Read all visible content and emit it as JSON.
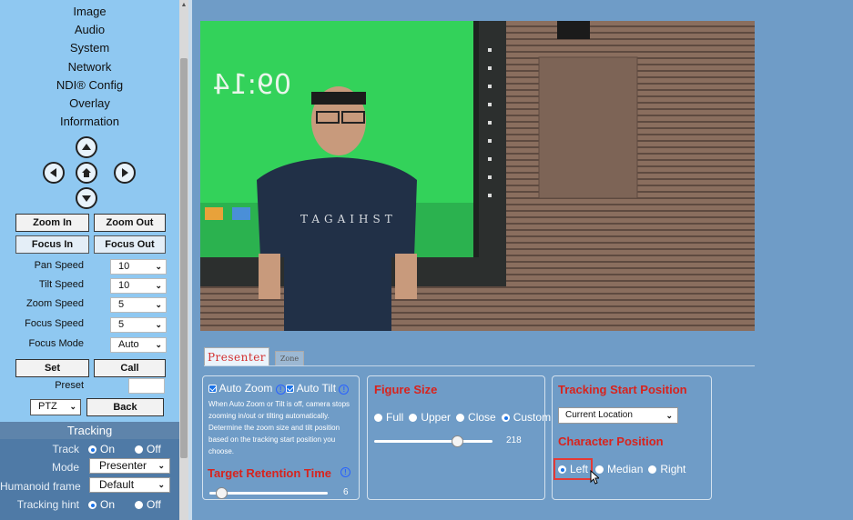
{
  "menu": {
    "items": [
      "Image",
      "Audio",
      "System",
      "Network",
      "NDI® Config",
      "Overlay",
      "Information"
    ]
  },
  "ptz": {
    "zoom_in": "Zoom In",
    "zoom_out": "Zoom Out",
    "focus_in": "Focus In",
    "focus_out": "Focus Out",
    "pan_speed_label": "Pan Speed",
    "pan_speed": "10",
    "tilt_speed_label": "Tilt Speed",
    "tilt_speed": "10",
    "zoom_speed_label": "Zoom Speed",
    "zoom_speed": "5",
    "focus_speed_label": "Focus Speed",
    "focus_speed": "5",
    "focus_mode_label": "Focus Mode",
    "focus_mode": "Auto",
    "set": "Set",
    "call": "Call",
    "preset_label": "Preset",
    "preset_value": "",
    "mode_select": "PTZ",
    "back": "Back"
  },
  "tracking": {
    "header": "Tracking",
    "track_label": "Track",
    "on": "On",
    "off": "Off",
    "mode_label": "Mode",
    "mode": "Presenter",
    "humanoid_label": "Humanoid frame",
    "humanoid": "Default",
    "hint_label": "Tracking hint"
  },
  "tabs": {
    "presenter": "Presenter",
    "zone": "Zone"
  },
  "auto_panel": {
    "auto_zoom": "Auto Zoom",
    "auto_tilt": "Auto Tilt",
    "desc": [
      "When Auto Zoom or Tilt is off, camera stops",
      "zooming in/out or tilting automatically.",
      "Determine the zoom size and tilt position",
      "based on the tracking start position you",
      "choose."
    ],
    "retention_title": "Target Retention Time",
    "retention_value": "6",
    "retention_fraction": 0.1
  },
  "figure_panel": {
    "title": "Figure Size",
    "options": [
      "Full",
      "Upper",
      "Close",
      "Custom"
    ],
    "selected": "Custom",
    "value": "218",
    "value_fraction": 0.7
  },
  "position_panel": {
    "start_title": "Tracking Start Position",
    "start_value": "Current Location",
    "char_title": "Character Position",
    "options": [
      "Left",
      "Median",
      "Right"
    ],
    "selected": "Left"
  },
  "video": {
    "wall_clock": "09:14"
  },
  "colors": {
    "accent_red": "#d8231d",
    "panel_bg": "#6f9cc7",
    "sidebar_bg": "#8fc8f1",
    "tracking_bg": "#4f7aa6"
  }
}
